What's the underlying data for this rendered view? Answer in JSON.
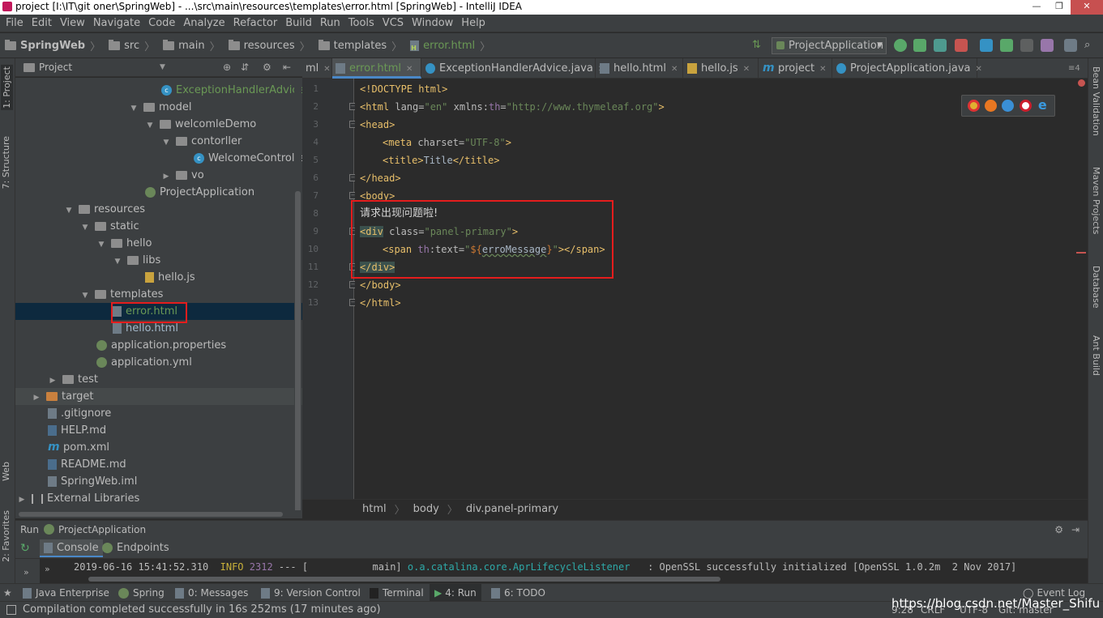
{
  "window": {
    "title": "project [I:\\IT\\git oner\\SpringWeb] - ...\\src\\main\\resources\\templates\\error.html [SpringWeb] - IntelliJ IDEA"
  },
  "menu": [
    "File",
    "Edit",
    "View",
    "Navigate",
    "Code",
    "Analyze",
    "Refactor",
    "Build",
    "Run",
    "Tools",
    "VCS",
    "Window",
    "Help"
  ],
  "nav": {
    "crumbs": [
      "SpringWeb",
      "src",
      "main",
      "resources",
      "templates",
      "error.html"
    ],
    "run_config": "ProjectApplication"
  },
  "left_strip": {
    "project": "1: Project",
    "structure": "7: Structure",
    "web": "Web",
    "favorites": "2: Favorites"
  },
  "right_strip": {
    "bean": "Bean Validation",
    "maven": "Maven Projects",
    "database": "Database",
    "ant": "Ant Build"
  },
  "project_panel": {
    "header": "Project",
    "tree": [
      {
        "label": "ExceptionHandlerAdvice",
        "icon": "class-icon",
        "style": "green"
      },
      {
        "label": "model",
        "icon": "folder-icon",
        "arrow": "▼"
      },
      {
        "label": "welcomleDemo",
        "icon": "folder-icon",
        "arrow": "▼"
      },
      {
        "label": "contorller",
        "icon": "folder-icon",
        "arrow": "▼"
      },
      {
        "label": "WelcomeController",
        "icon": "class-icon"
      },
      {
        "label": "vo",
        "icon": "folder-icon",
        "arrow": "▶"
      },
      {
        "label": "ProjectApplication",
        "icon": "spring-class-icon"
      },
      {
        "label": "resources",
        "icon": "folder-icon",
        "arrow": "▼"
      },
      {
        "label": "static",
        "icon": "folder-icon",
        "arrow": "▼"
      },
      {
        "label": "hello",
        "icon": "folder-icon",
        "arrow": "▼"
      },
      {
        "label": "libs",
        "icon": "folder-icon",
        "arrow": "▼"
      },
      {
        "label": "hello.js",
        "icon": "js-file-icon"
      },
      {
        "label": "templates",
        "icon": "folder-icon",
        "arrow": "▼"
      },
      {
        "label": "error.html",
        "icon": "html-file-icon",
        "style": "green",
        "selected": true
      },
      {
        "label": "hello.html",
        "icon": "html-file-icon",
        "style": "blue"
      },
      {
        "label": "application.properties",
        "icon": "spring-file-icon"
      },
      {
        "label": "application.yml",
        "icon": "spring-file-icon"
      },
      {
        "label": "test",
        "icon": "folder-icon",
        "arrow": "▶"
      },
      {
        "label": "target",
        "icon": "target-folder-icon",
        "arrow": "▶"
      },
      {
        "label": ".gitignore",
        "icon": "file-icon"
      },
      {
        "label": "HELP.md",
        "icon": "md-file-icon"
      },
      {
        "label": "pom.xml",
        "icon": "maven-icon"
      },
      {
        "label": "README.md",
        "icon": "md-file-icon"
      },
      {
        "label": "SpringWeb.iml",
        "icon": "file-icon"
      },
      {
        "label": "External Libraries",
        "icon": "library-icon",
        "arrow": "▶"
      }
    ]
  },
  "editor": {
    "tabs": [
      {
        "label": "ml",
        "icon": "none"
      },
      {
        "label": "error.html",
        "icon": "html-file-icon",
        "active": true
      },
      {
        "label": "ExceptionHandlerAdvice.java",
        "icon": "class-icon"
      },
      {
        "label": "hello.html",
        "icon": "html-file-icon"
      },
      {
        "label": "hello.js",
        "icon": "js-file-icon"
      },
      {
        "label": "project",
        "icon": "maven-icon"
      },
      {
        "label": "ProjectApplication.java",
        "icon": "class-icon"
      }
    ],
    "tabs_overflow": "≡4",
    "line_numbers": [
      "1",
      "2",
      "3",
      "4",
      "5",
      "6",
      "7",
      "8",
      "9",
      "10",
      "11",
      "12",
      "13"
    ],
    "code": {
      "l1a": "<!DOCTYPE",
      "l1b": " html>",
      "l2a": "<html",
      "l2b": " lang=",
      "l2c": "\"en\"",
      "l2d": " xmlns:",
      "l2e": "th",
      "l2f": "=",
      "l2g": "\"http://www.thymeleaf.org\"",
      "l2h": ">",
      "l3": "<head>",
      "l4a": "<meta",
      "l4b": " charset=",
      "l4c": "\"UTF-8\"",
      "l4d": ">",
      "l5a": "<title>",
      "l5b": "Title",
      "l5c": "</title>",
      "l6": "</head>",
      "l7": "<body>",
      "l8": "请求出现问题啦!",
      "l9a": "<div",
      "l9b": " class=",
      "l9c": "\"panel-primary\"",
      "l9d": ">",
      "l10a": "<span",
      "l10b": " th",
      "l10c": ":text=",
      "l10d": "\"",
      "l10e": "${",
      "l10f": "erroMessage",
      "l10g": "}",
      "l10h": "\"",
      "l10i": "></span>",
      "l11": "</div>",
      "l12": "</body>",
      "l13": "</html>"
    },
    "breadcrumbs": [
      "html",
      "body",
      "div.panel-primary"
    ]
  },
  "run_panel": {
    "header_prefix": "Run",
    "header_config": "ProjectApplication",
    "tabs": [
      "Console",
      "Endpoints"
    ],
    "log": {
      "time": "2019-06-16 15:41:52.310",
      "level": "INFO",
      "pid": "2312",
      "sep": "---",
      "thread": "[           main]",
      "logger": "o.a.catalina.core.AprLifecycleListener",
      "message": "   : OpenSSL successfully initialized [OpenSSL 1.0.2m  2 Nov 2017]"
    }
  },
  "tool_windows": [
    "Java Enterprise",
    "Spring",
    "0: Messages",
    "9: Version Control",
    "Terminal",
    "4: Run",
    "6: TODO"
  ],
  "event_log": "Event Log",
  "status": {
    "message": "Compilation completed successfully in 16s 252ms (17 minutes ago)",
    "position": "9:28",
    "line_sep": "CRLF",
    "encoding": "UTF-8",
    "git": "Git: master"
  },
  "watermark": "https://blog.csdn.net/Master_Shifu",
  "colors": {
    "accent": "#4a88c7",
    "highlight_box": "#e51d1d",
    "tag": "#e8bf6a",
    "string": "#6a8759"
  }
}
